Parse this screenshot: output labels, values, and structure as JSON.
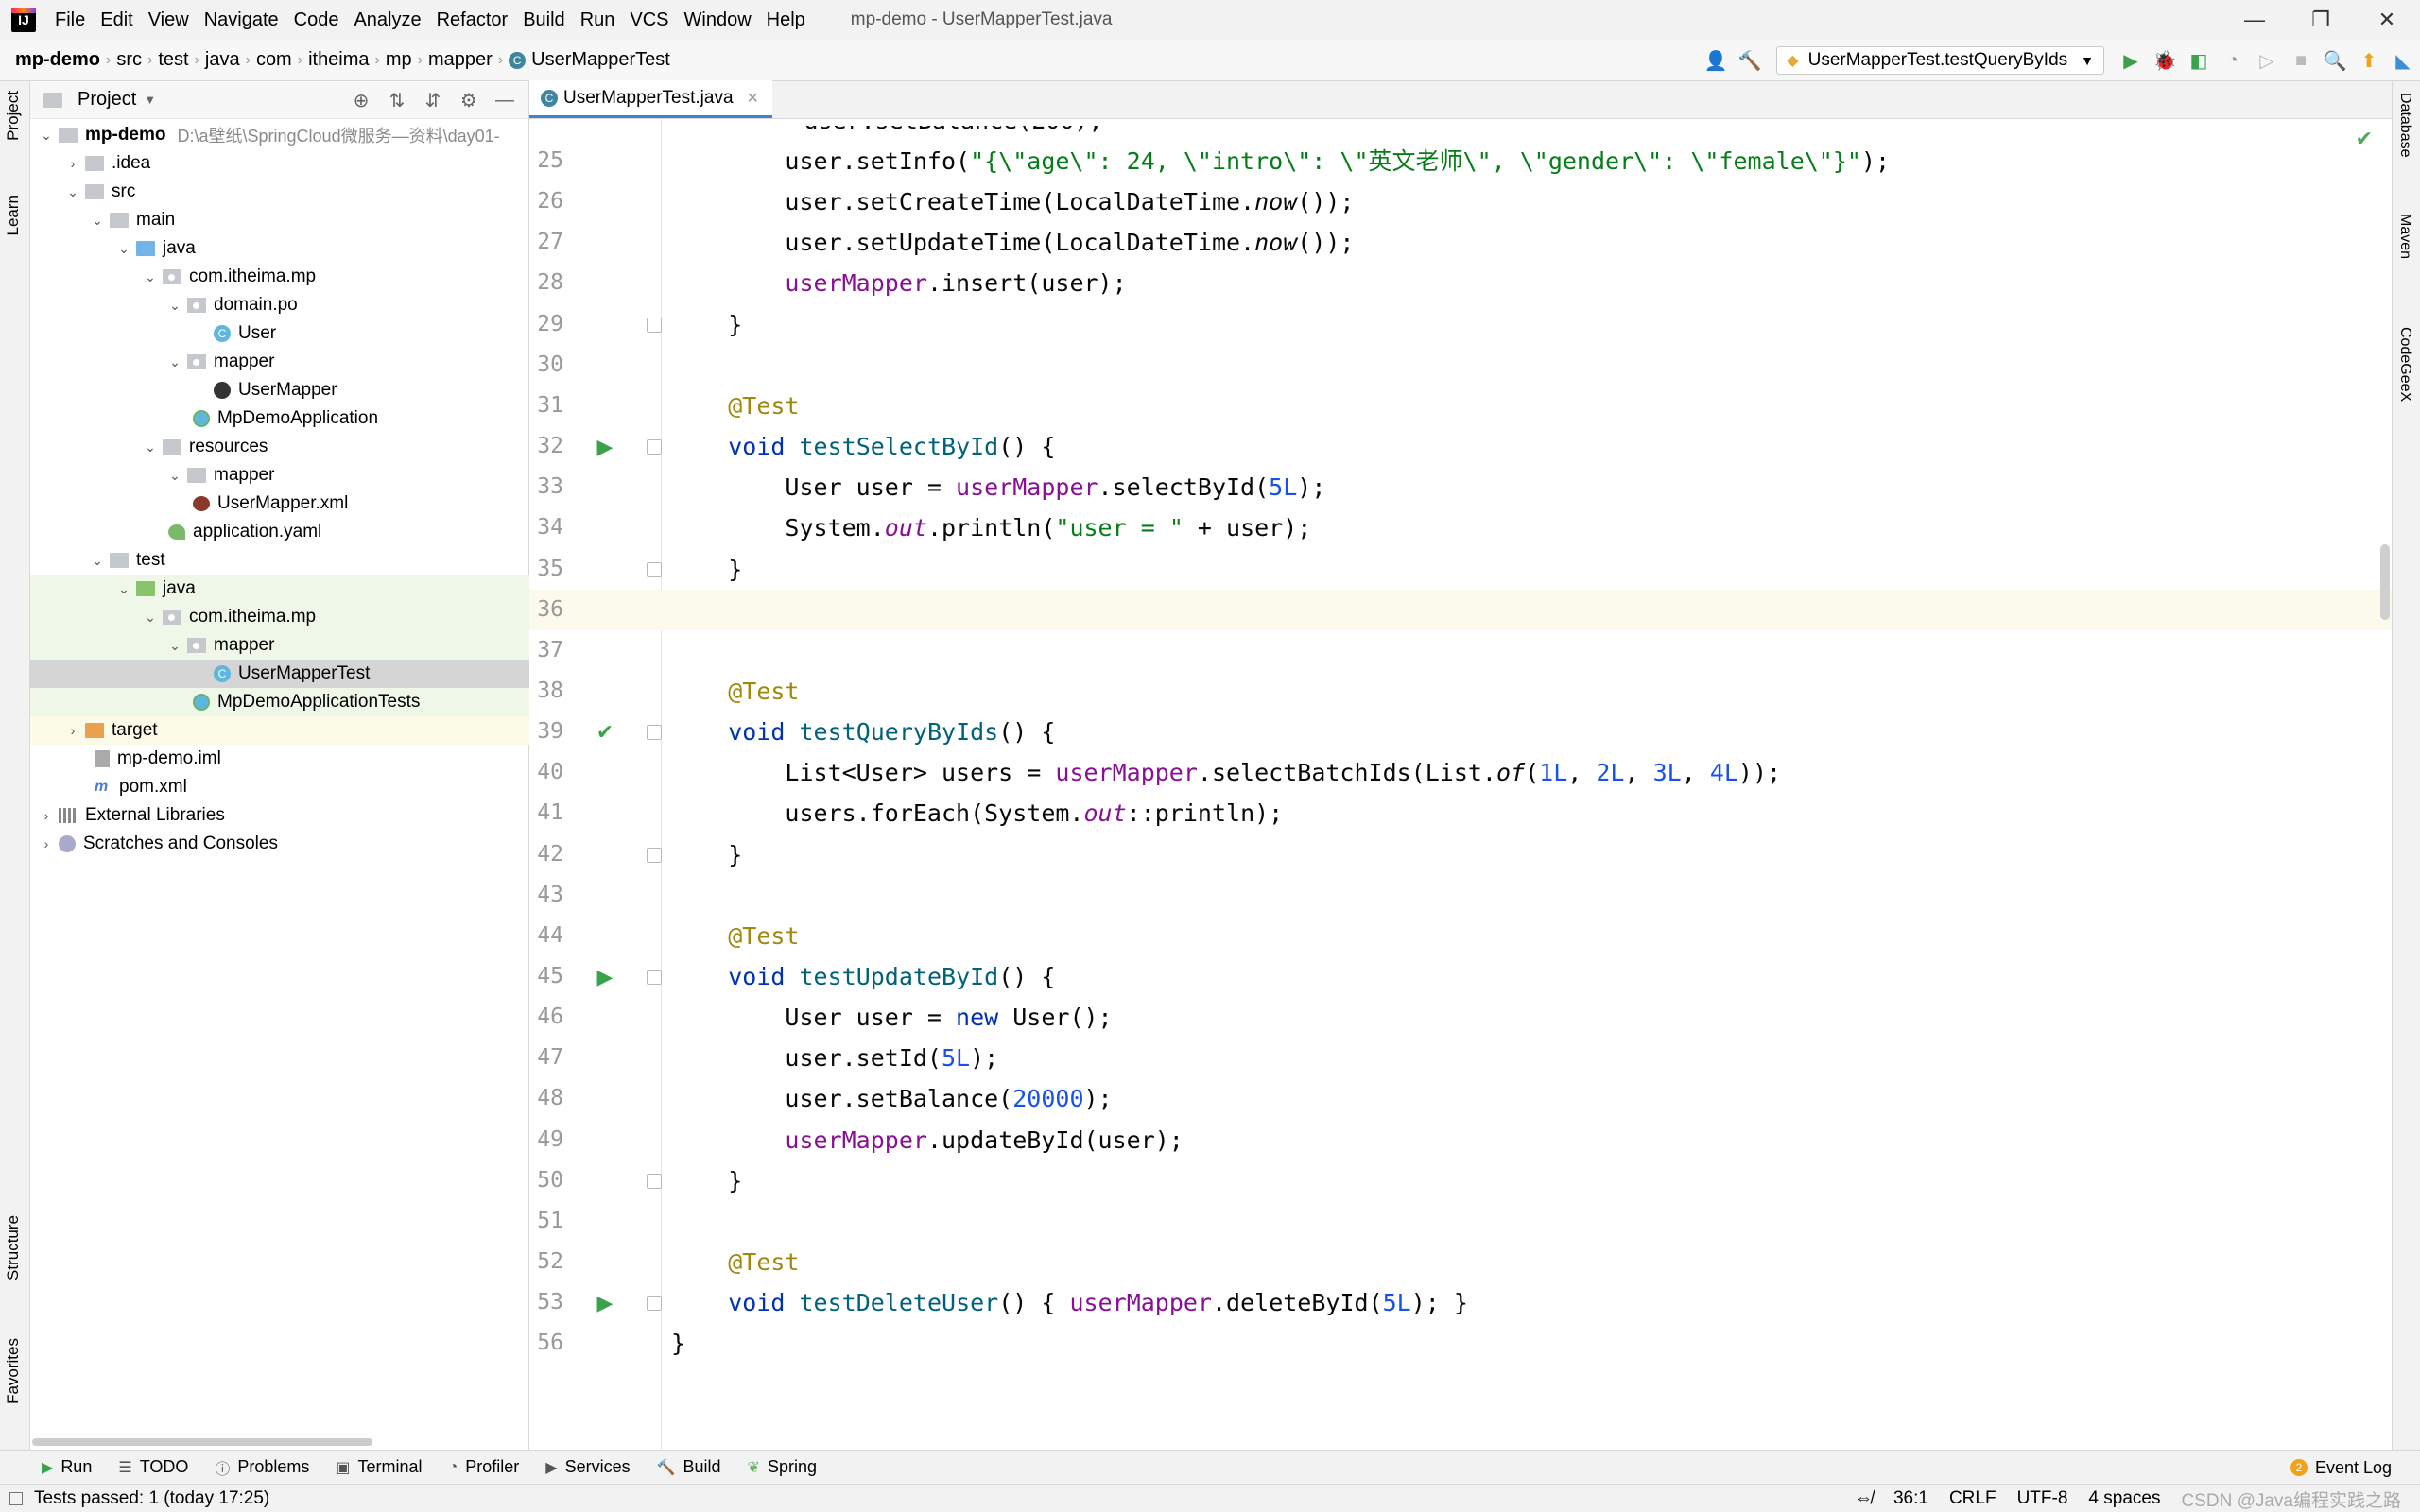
{
  "menubar": {
    "items": [
      "File",
      "Edit",
      "View",
      "Navigate",
      "Code",
      "Analyze",
      "Refactor",
      "Build",
      "Run",
      "VCS",
      "Window",
      "Help"
    ],
    "window_title": "mp-demo - UserMapperTest.java"
  },
  "navbar": {
    "breadcrumbs": [
      "mp-demo",
      "src",
      "test",
      "java",
      "com",
      "itheima",
      "mp",
      "mapper",
      "UserMapperTest"
    ],
    "run_config": "UserMapperTest.testQueryByIds"
  },
  "left_strip": {
    "tabs": [
      "Project",
      "Learn",
      "Structure",
      "Favorites"
    ]
  },
  "right_strip": {
    "tabs": [
      "Database",
      "Maven",
      "CodeGeeX"
    ]
  },
  "project_panel": {
    "title": "Project",
    "root_name": "mp-demo",
    "root_path": "D:\\a壁纸\\SpringCloud微服务—资料\\day01-",
    "items": [
      {
        "label": ".idea"
      },
      {
        "label": "src"
      },
      {
        "label": "main"
      },
      {
        "label": "java"
      },
      {
        "label": "com.itheima.mp"
      },
      {
        "label": "domain.po"
      },
      {
        "label": "User"
      },
      {
        "label": "mapper"
      },
      {
        "label": "UserMapper"
      },
      {
        "label": "MpDemoApplication"
      },
      {
        "label": "resources"
      },
      {
        "label": "mapper"
      },
      {
        "label": "UserMapper.xml"
      },
      {
        "label": "application.yaml"
      },
      {
        "label": "test"
      },
      {
        "label": "java"
      },
      {
        "label": "com.itheima.mp"
      },
      {
        "label": "mapper"
      },
      {
        "label": "UserMapperTest"
      },
      {
        "label": "MpDemoApplicationTests"
      },
      {
        "label": "target"
      },
      {
        "label": "mp-demo.iml"
      },
      {
        "label": "pom.xml"
      },
      {
        "label": "External Libraries"
      },
      {
        "label": "Scratches and Consoles"
      }
    ]
  },
  "editor": {
    "tab": "UserMapperTest.java",
    "lines": [
      {
        "n": "25",
        "text": "        user.setInfo(\"{\\\"age\\\": 24, \\\"intro\\\": \\\"英文老师\\\", \\\"gender\\\": \\\"female\\\"}\");"
      },
      {
        "n": "26",
        "text": "        user.setCreateTime(LocalDateTime.now());"
      },
      {
        "n": "27",
        "text": "        user.setUpdateTime(LocalDateTime.now());"
      },
      {
        "n": "28",
        "text": "        userMapper.insert(user);"
      },
      {
        "n": "29",
        "text": "    }"
      },
      {
        "n": "30",
        "text": ""
      },
      {
        "n": "31",
        "text": "    @Test"
      },
      {
        "n": "32",
        "text": "    void testSelectById() {"
      },
      {
        "n": "33",
        "text": "        User user = userMapper.selectById(5L);"
      },
      {
        "n": "34",
        "text": "        System.out.println(\"user = \" + user);"
      },
      {
        "n": "35",
        "text": "    }"
      },
      {
        "n": "36",
        "text": ""
      },
      {
        "n": "37",
        "text": ""
      },
      {
        "n": "38",
        "text": "    @Test"
      },
      {
        "n": "39",
        "text": "    void testQueryByIds() {"
      },
      {
        "n": "40",
        "text": "        List<User> users = userMapper.selectBatchIds(List.of(1L, 2L, 3L, 4L));"
      },
      {
        "n": "41",
        "text": "        users.forEach(System.out::println);"
      },
      {
        "n": "42",
        "text": "    }"
      },
      {
        "n": "43",
        "text": ""
      },
      {
        "n": "44",
        "text": "    @Test"
      },
      {
        "n": "45",
        "text": "    void testUpdateById() {"
      },
      {
        "n": "46",
        "text": "        User user = new User();"
      },
      {
        "n": "47",
        "text": "        user.setId(5L);"
      },
      {
        "n": "48",
        "text": "        user.setBalance(20000);"
      },
      {
        "n": "49",
        "text": "        userMapper.updateById(user);"
      },
      {
        "n": "50",
        "text": "    }"
      },
      {
        "n": "51",
        "text": ""
      },
      {
        "n": "52",
        "text": "    @Test"
      },
      {
        "n": "53",
        "text": "    void testDeleteUser() { userMapper.deleteById(5L); }"
      },
      {
        "n": "56",
        "text": "}"
      }
    ]
  },
  "bottom_tools": [
    "Run",
    "TODO",
    "Problems",
    "Terminal",
    "Profiler",
    "Services",
    "Build",
    "Spring"
  ],
  "event_log": {
    "label": "Event Log",
    "count": "2"
  },
  "status": {
    "message": "Tests passed: 1 (today 17:25)",
    "position": "36:1",
    "line_sep": "CRLF",
    "encoding": "UTF-8",
    "indent": "4 spaces",
    "watermark": "CSDN @Java编程实践之路"
  }
}
